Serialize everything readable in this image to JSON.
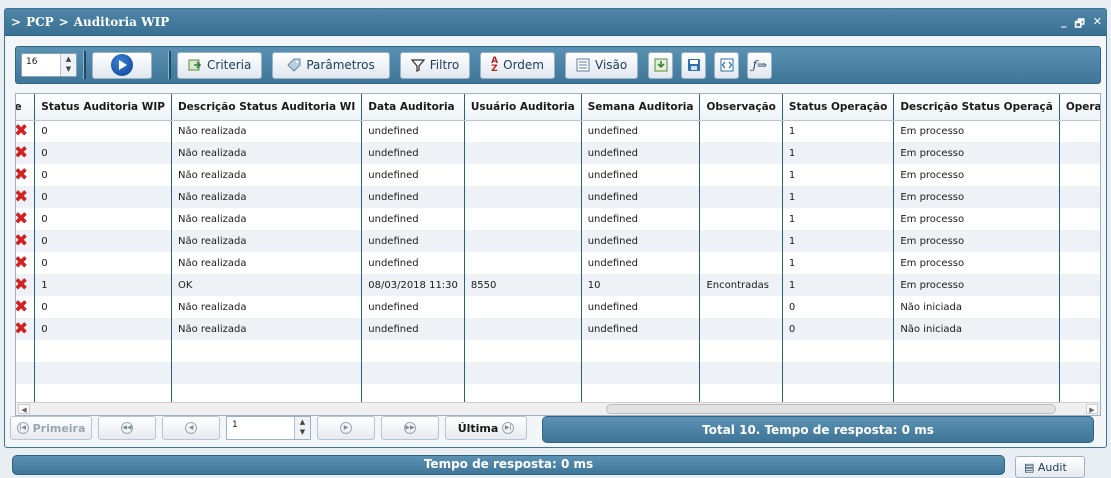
{
  "window": {
    "breadcrumb": [
      ">",
      "PCP",
      ">",
      "Auditoria WIP"
    ],
    "controls": [
      "_",
      "🗗",
      "✕"
    ]
  },
  "toolbar": {
    "page_size": "16",
    "buttons": {
      "criteria": "Criteria",
      "parametros": "Parâmetros",
      "filtro": "Filtro",
      "ordem": "Ordem",
      "visao": "Visão"
    }
  },
  "grid": {
    "columns": [
      "nte",
      "Status Auditoria WIP",
      "Descrição Status Auditoria WI",
      "Data Auditoria",
      "Usuário Auditoria",
      "Semana Auditoria",
      "Observação",
      "Status Operação",
      "Descrição Status Operaçã",
      "Opera"
    ],
    "rows": [
      [
        "✖",
        "0",
        "Não realizada",
        "undefined",
        "",
        "undefined",
        "",
        "1",
        "Em processo",
        ""
      ],
      [
        "✖",
        "0",
        "Não realizada",
        "undefined",
        "",
        "undefined",
        "",
        "1",
        "Em processo",
        ""
      ],
      [
        "✖",
        "0",
        "Não realizada",
        "undefined",
        "",
        "undefined",
        "",
        "1",
        "Em processo",
        ""
      ],
      [
        "✖",
        "0",
        "Não realizada",
        "undefined",
        "",
        "undefined",
        "",
        "1",
        "Em processo",
        ""
      ],
      [
        "✖",
        "0",
        "Não realizada",
        "undefined",
        "",
        "undefined",
        "",
        "1",
        "Em processo",
        ""
      ],
      [
        "✖",
        "0",
        "Não realizada",
        "undefined",
        "",
        "undefined",
        "",
        "1",
        "Em processo",
        ""
      ],
      [
        "✖",
        "0",
        "Não realizada",
        "undefined",
        "",
        "undefined",
        "",
        "1",
        "Em processo",
        ""
      ],
      [
        "✖",
        "1",
        "OK",
        "08/03/2018 11:30",
        "8550",
        "10",
        "Encontradas",
        "1",
        "Em processo",
        ""
      ],
      [
        "✖",
        "0",
        "Não realizada",
        "undefined",
        "",
        "undefined",
        "",
        "0",
        "Não iniciada",
        ""
      ],
      [
        "✖",
        "0",
        "Não realizada",
        "undefined",
        "",
        "undefined",
        "",
        "0",
        "Não iniciada",
        ""
      ],
      [
        "",
        "",
        "",
        "",
        "",
        "",
        "",
        "",
        "",
        ""
      ],
      [
        "",
        "",
        "",
        "",
        "",
        "",
        "",
        "",
        "",
        ""
      ],
      [
        "",
        "",
        "",
        "",
        "",
        "",
        "",
        "",
        "",
        ""
      ]
    ]
  },
  "pager": {
    "first": "Primeira",
    "last": "Última",
    "current_page": "1",
    "total_text": "Total 10. Tempo de resposta: 0 ms"
  },
  "footer": {
    "response_text": "Tempo de resposta: 0 ms",
    "audit_button": "Audit"
  }
}
